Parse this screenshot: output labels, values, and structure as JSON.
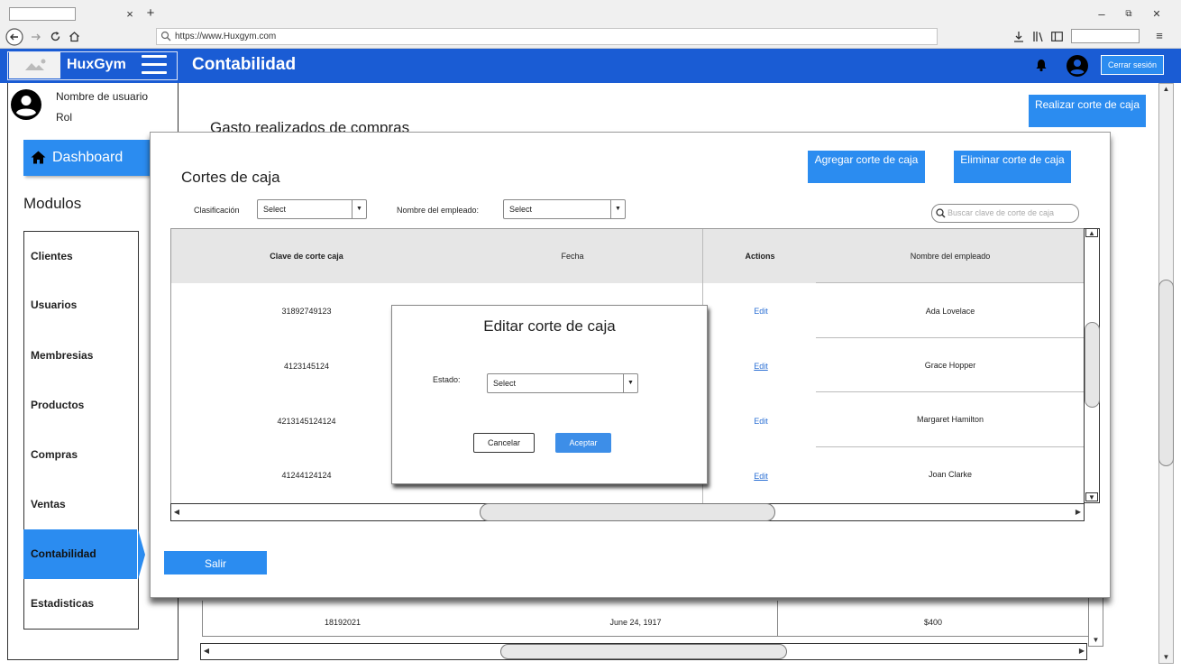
{
  "browser": {
    "url": "https://www.Huxgym.com",
    "tab_close": "×",
    "new_tab": "+",
    "win_min": "–",
    "win_restore": "⧉",
    "win_close": "✕",
    "menu": "≡"
  },
  "header": {
    "brand": "HuxGym",
    "title": "Contabilidad",
    "logout_label": "Cerrar sesión"
  },
  "sidebar": {
    "user_name": "Nombre de usuario",
    "user_role": "Rol",
    "dashboard_label": "Dashboard",
    "modules_title": "Modulos",
    "items": [
      {
        "label": "Clientes"
      },
      {
        "label": "Usuarios"
      },
      {
        "label": "Membresias"
      },
      {
        "label": "Productos"
      },
      {
        "label": "Compras"
      },
      {
        "label": "Ventas"
      },
      {
        "label": "Contabilidad",
        "active": true
      },
      {
        "label": "Estadisticas"
      }
    ]
  },
  "main": {
    "section_title": "Gasto realizados de compras",
    "realizar_label": "Realizar corte de caja",
    "background_row": {
      "clave": "18192021",
      "fecha": "June 24, 1917",
      "monto": "$400"
    }
  },
  "cortes_modal": {
    "title": "Cortes de caja",
    "agregar_label": "Agregar corte de caja",
    "eliminar_label": "Eliminar corte de caja",
    "filter_clasificacion_label": "Clasificación",
    "filter_clasificacion_value": "Select",
    "filter_empleado_label": "Nombre del empleado:",
    "filter_empleado_value": "Select",
    "search_placeholder": "Buscar clave de corte de caja",
    "columns": [
      "Clave de corte caja",
      "Fecha",
      "Actions",
      "Nombre del empleado"
    ],
    "rows": [
      {
        "clave": "31892749123",
        "action": "Edit",
        "empleado": "Ada Lovelace"
      },
      {
        "clave": "4123145124",
        "action": "Edit",
        "empleado": "Grace Hopper"
      },
      {
        "clave": "4213145124124",
        "action": "Edit",
        "empleado": "Margaret Hamilton"
      },
      {
        "clave": "41244124124",
        "action": "Edit",
        "empleado": "Joan Clarke"
      }
    ],
    "salir_label": "Salir"
  },
  "edit_dialog": {
    "title": "Editar corte de caja",
    "estado_label": "Estado:",
    "estado_value": "Select",
    "cancel_label": "Cancelar",
    "accept_label": "Aceptar"
  },
  "icons": {
    "bell": "bell-icon",
    "avatar": "user-avatar-icon",
    "home": "home-icon",
    "search": "search-icon",
    "hamburger": "hamburger-icon"
  },
  "colors": {
    "header_blue": "#1a5cd4",
    "button_blue": "#2b8cf0"
  }
}
